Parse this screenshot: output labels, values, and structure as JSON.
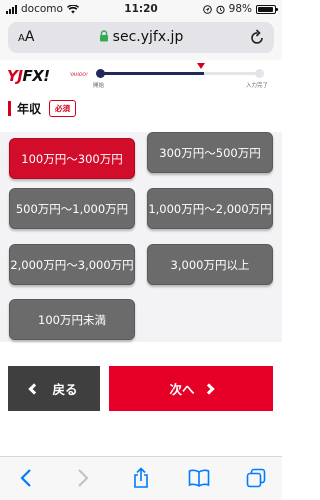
{
  "status_bar": {
    "carrier": "docomo",
    "time": "11:20",
    "battery": "98%"
  },
  "browser": {
    "aa": "A",
    "aa_small": "A",
    "url": "sec.yjfx.jp"
  },
  "header": {
    "logo_y": "YJ",
    "logo_fx": "FX!",
    "logo_sub": "YAHOO!",
    "progress_start_label": "開始",
    "progress_end_label": "入力完了",
    "progress": 0.65
  },
  "question": {
    "title": "年収",
    "badge": "必須"
  },
  "options": [
    {
      "label": "100万円～300万円",
      "selected": true
    },
    {
      "label": "300万円～500万円",
      "selected": false
    },
    {
      "label": "500万円～1,000万円",
      "selected": false
    },
    {
      "label": "1,000万円～2,000万円",
      "selected": false
    },
    {
      "label": "2,000万円～3,000万円",
      "selected": false
    },
    {
      "label": "3,000万円以上",
      "selected": false
    },
    {
      "label": "100万円未満",
      "selected": false
    }
  ],
  "nav": {
    "back_label": "戻る",
    "next_label": "次へ"
  },
  "colors": {
    "accent": "#e60027",
    "selected": "#d20d2b",
    "unselected": "#6b6b6b",
    "back": "#3f3f3f",
    "ios_blue": "#007aff"
  },
  "toolbar": {
    "icons": [
      "back-icon",
      "forward-icon",
      "share-icon",
      "bookmarks-icon",
      "tabs-icon"
    ]
  }
}
